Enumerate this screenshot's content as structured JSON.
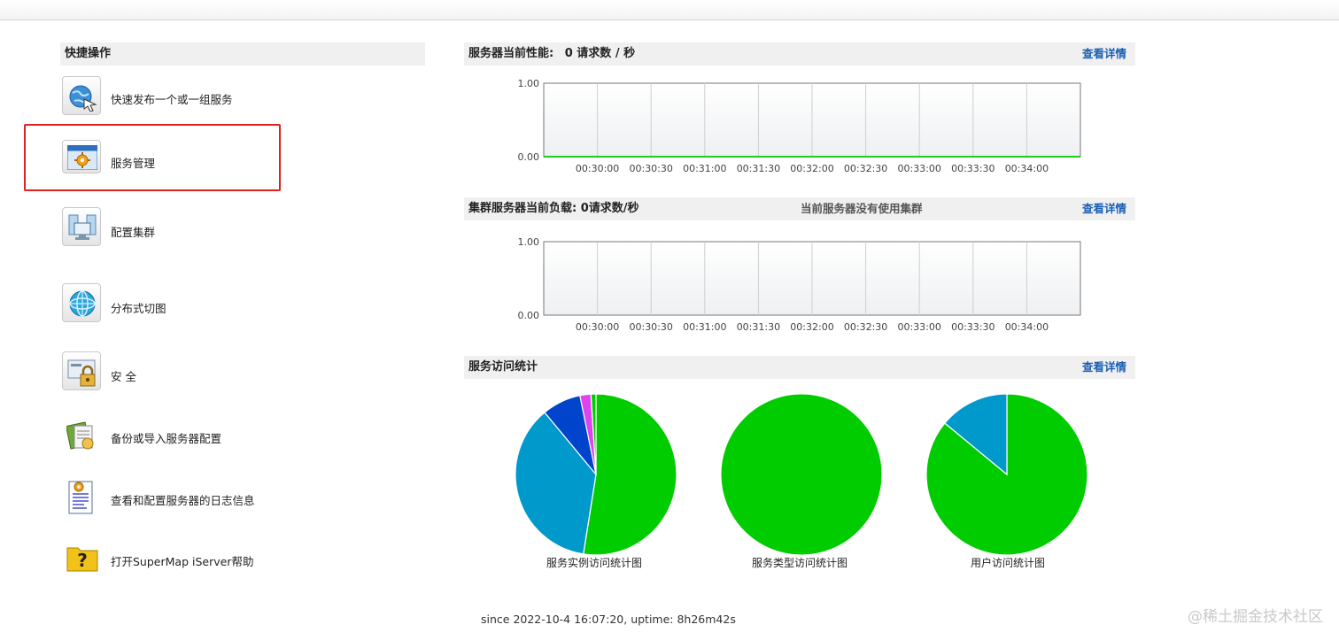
{
  "quick_actions": {
    "title": "快捷操作",
    "items": [
      {
        "label": "快速发布一个或一组服务",
        "icon": "globe-publish-icon"
      },
      {
        "label": "服务管理",
        "icon": "service-management-gear-icon"
      },
      {
        "label": "配置集群",
        "icon": "cluster-servers-icon"
      },
      {
        "label": "分布式切图",
        "icon": "distributed-tiles-globe-icon"
      },
      {
        "label": "安 全",
        "icon": "security-lock-icon"
      },
      {
        "label": "备份或导入服务器配置",
        "icon": "backup-import-icon"
      },
      {
        "label": "查看和配置服务器的日志信息",
        "icon": "log-document-icon"
      },
      {
        "label": "打开SuperMap iServer帮助",
        "icon": "help-folder-icon"
      }
    ]
  },
  "performance": {
    "title": "服务器当前性能:",
    "value_text": "0 请求数 / 秒",
    "details_link": "查看详情"
  },
  "cluster": {
    "title": "集群服务器当前负载:",
    "value_text": "0请求数/秒",
    "status_text": "当前服务器没有使用集群",
    "details_link": "查看详情"
  },
  "access_stats": {
    "title": "服务访问统计",
    "details_link": "查看详情"
  },
  "chart_data": [
    {
      "type": "line",
      "x": [
        "00:30:00",
        "00:30:30",
        "00:31:00",
        "00:31:30",
        "00:32:00",
        "00:32:30",
        "00:33:00",
        "00:33:30",
        "00:34:00"
      ],
      "series": [
        {
          "values": [
            0,
            0,
            0,
            0,
            0,
            0,
            0,
            0,
            0,
            0,
            0
          ],
          "color": "#22cc22"
        }
      ],
      "y_ticks": [
        "1.00",
        "0.00"
      ],
      "ylim": [
        0,
        1
      ],
      "grid": true
    },
    {
      "type": "line",
      "x": [
        "00:30:00",
        "00:30:30",
        "00:31:00",
        "00:31:30",
        "00:32:00",
        "00:32:30",
        "00:33:00",
        "00:33:30",
        "00:34:00"
      ],
      "series": [],
      "y_ticks": [
        "1.00",
        "0.00"
      ],
      "ylim": [
        0,
        1
      ],
      "grid": true
    },
    {
      "type": "pie",
      "title": "服务实例访问统计图",
      "slices": [
        {
          "value": 52.5,
          "color": "#00cc00"
        },
        {
          "value": 36.5,
          "color": "#0099cc"
        },
        {
          "value": 7.8,
          "color": "#0044cc"
        },
        {
          "value": 2.2,
          "color": "#dd44ee"
        },
        {
          "value": 1.0,
          "color": "#00cc00"
        }
      ]
    },
    {
      "type": "pie",
      "title": "服务类型访问统计图",
      "slices": [
        {
          "value": 100,
          "color": "#00cc00"
        }
      ]
    },
    {
      "type": "pie",
      "title": "用户访问统计图",
      "slices": [
        {
          "value": 86,
          "color": "#00cc00"
        },
        {
          "value": 14,
          "color": "#0099cc"
        }
      ]
    }
  ],
  "footer": {
    "text": "since 2022-10-4 16:07:20, uptime: 8h26m42s"
  },
  "watermark": "@稀土掘金技术社区"
}
